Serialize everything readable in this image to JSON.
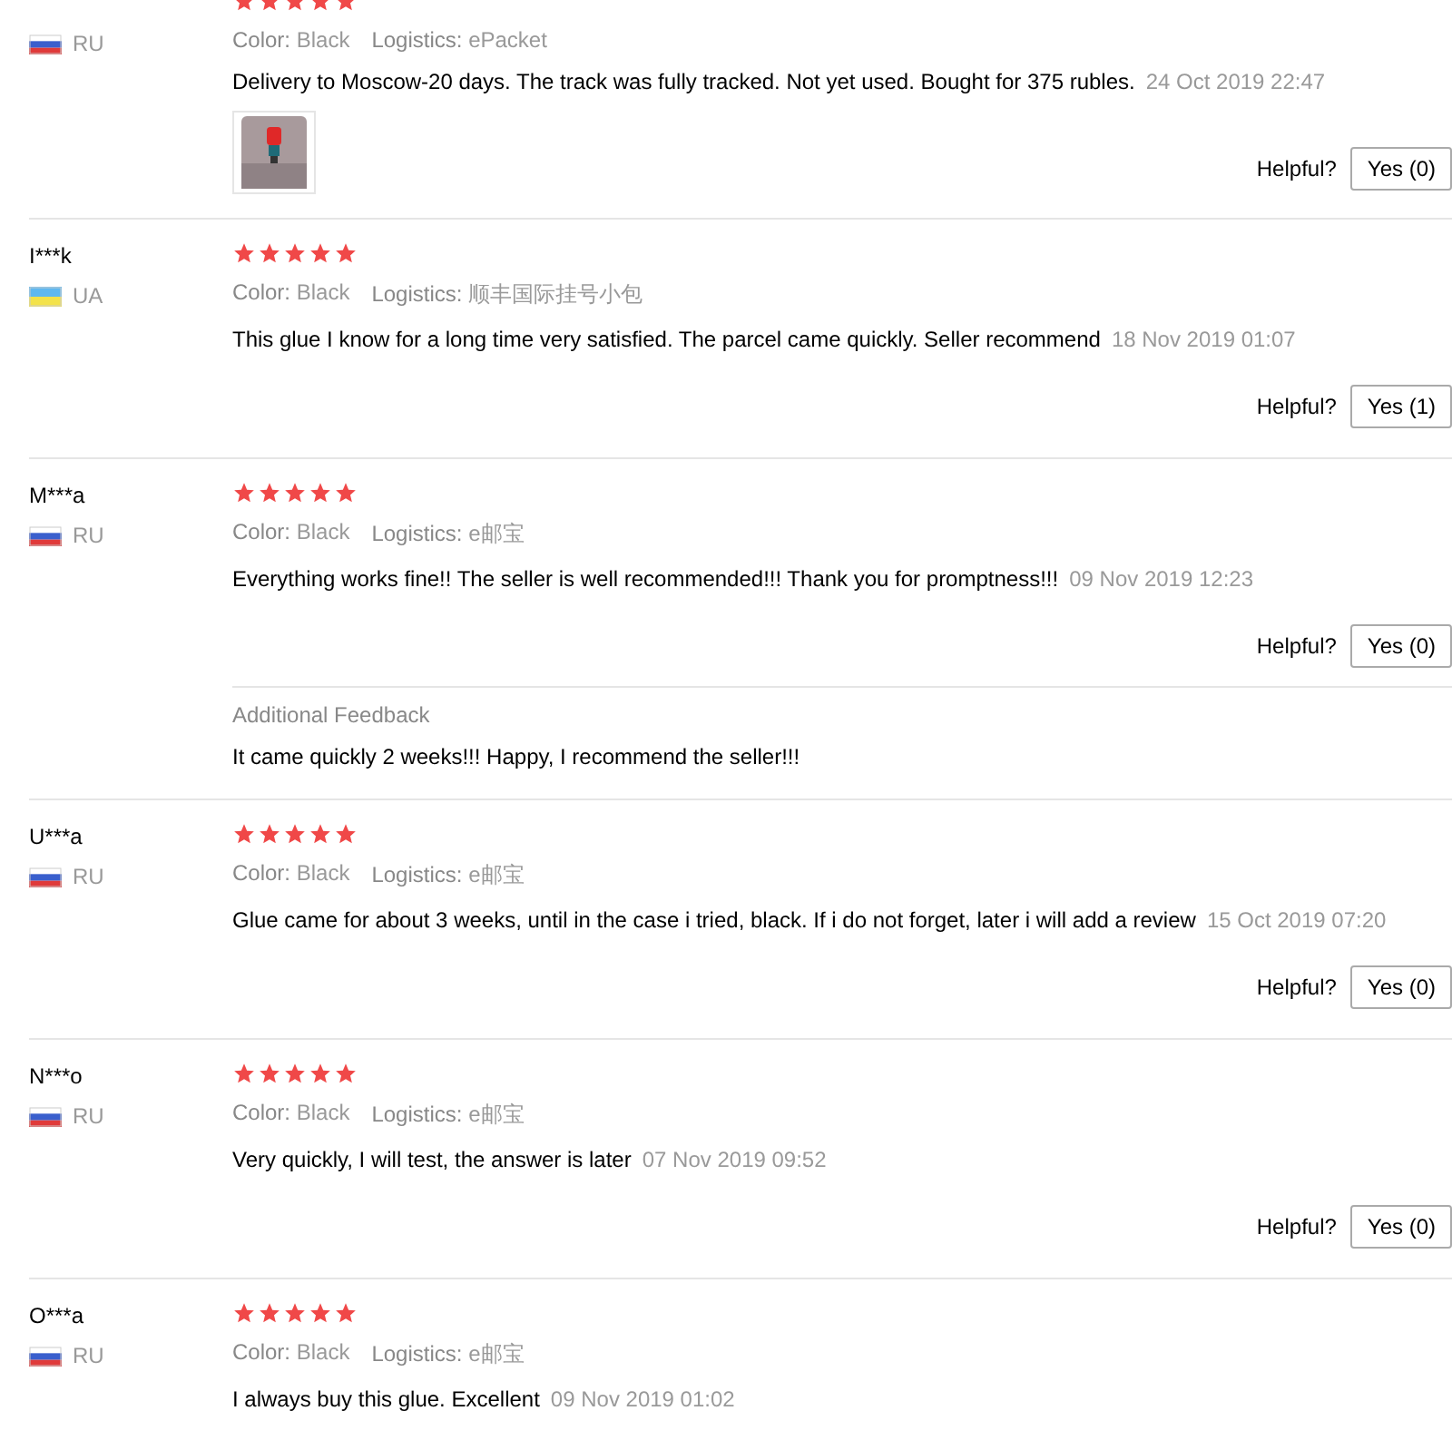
{
  "reviews": [
    {
      "flag": {
        "kind": "ru"
      },
      "country": "RU",
      "stars": 5,
      "color_label": "Color:",
      "color_value": "Black",
      "logistics_label": "Logistics:",
      "logistics": "ePacket",
      "text": "Delivery to Moscow-20 days. The track was fully tracked. Not yet used. Bought for 375 rubles.",
      "date": "24 Oct 2019 22:47",
      "photos": [
        {
          "kind": "picture"
        }
      ],
      "helpful_label": "Helpful?",
      "helpful_button": "Yes (0)"
    },
    {
      "name": "I***k",
      "flag": {
        "kind": "ua"
      },
      "country": "UA",
      "stars": 5,
      "color_label": "Color:",
      "color_value": "Black",
      "logistics_label": "Logistics:",
      "logistics": "顺丰国际挂号小包",
      "text": "This glue I know for a long time very satisfied. The parcel came quickly. Seller recommend",
      "date": "18 Nov 2019 01:07",
      "helpful_label": "Helpful?",
      "helpful_button": "Yes (1)"
    },
    {
      "name": "M***a",
      "flag": {
        "kind": "ru"
      },
      "country": "RU",
      "stars": 5,
      "color_label": "Color:",
      "color_value": "Black",
      "logistics_label": "Logistics:",
      "logistics": "e邮宝",
      "text": "Everything works fine!! The seller is well recommended!!! Thank you for promptness!!!",
      "date": "09 Nov 2019 12:23",
      "helpful_label": "Helpful?",
      "helpful_button": "Yes (0)",
      "additional": {
        "title": "Additional Feedback",
        "text": "It came quickly 2 weeks!!! Happy, I recommend the seller!!!"
      }
    },
    {
      "name": "U***a",
      "flag": {
        "kind": "ru"
      },
      "country": "RU",
      "stars": 5,
      "color_label": "Color:",
      "color_value": "Black",
      "logistics_label": "Logistics:",
      "logistics": "e邮宝",
      "text": "Glue came for about 3 weeks, until in the case i tried, black. If i do not forget, later i will add a review",
      "date": "15 Oct 2019 07:20",
      "helpful_label": "Helpful?",
      "helpful_button": "Yes (0)"
    },
    {
      "name": "N***o",
      "flag": {
        "kind": "ru"
      },
      "country": "RU",
      "stars": 5,
      "color_label": "Color:",
      "color_value": "Black",
      "logistics_label": "Logistics:",
      "logistics": "e邮宝",
      "text": "Very quickly, I will test, the answer is later",
      "date": "07 Nov 2019 09:52",
      "helpful_label": "Helpful?",
      "helpful_button": "Yes (0)"
    },
    {
      "name": "O***a",
      "flag": {
        "kind": "ru"
      },
      "country": "RU",
      "stars": 5,
      "color_label": "Color:",
      "color_value": "Black",
      "logistics_label": "Logistics:",
      "logistics": "e邮宝",
      "text": "I always buy this glue. Excellent",
      "date": "09 Nov 2019 01:02"
    }
  ]
}
